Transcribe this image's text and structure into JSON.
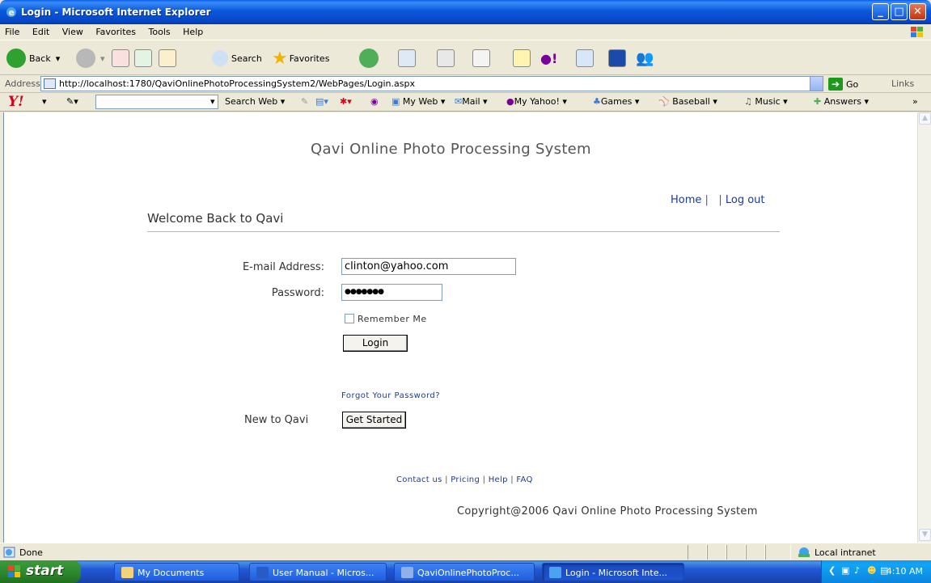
{
  "window": {
    "title": "Login - Microsoft Internet Explorer"
  },
  "menu": [
    "File",
    "Edit",
    "View",
    "Favorites",
    "Tools",
    "Help"
  ],
  "toolbar": {
    "back_label": "Back",
    "search_label": "Search",
    "favorites_label": "Favorites"
  },
  "address": {
    "label": "Address",
    "url": "http://localhost:1780/QaviOnlinePhotoProcessingSystem2/WebPages/Login.aspx",
    "go_label": "Go",
    "links_label": "Links"
  },
  "yahoo": {
    "logo": "Y!",
    "search_web": "Search Web",
    "items": [
      "My Web",
      "Mail",
      "My Yahoo!",
      "Games",
      "Baseball",
      "Music",
      "Answers"
    ]
  },
  "page": {
    "site_title": "Qavi Online Photo Processing System",
    "nav_home": "Home",
    "nav_sep1": "|",
    "nav_sep2": "|",
    "nav_logout": "Log out",
    "welcome": "Welcome Back to Qavi",
    "email_label": "E-mail Address:",
    "email_value": "clinton@yahoo.com",
    "password_label": "Password:",
    "password_value": "●●●●●●●",
    "remember_label": "Remember Me",
    "login_button": "Login",
    "forgot_link": "Forgot Your Password?",
    "new_label": "New to Qavi",
    "get_started_button": "Get Started",
    "footer": {
      "contact": "Contact us",
      "pricing": "Pricing",
      "help": "Help",
      "faq": "FAQ",
      "sep": "|"
    },
    "copyright": "Copyright@2006 Qavi Online Photo Processing System"
  },
  "status": {
    "text": "Done",
    "zone": "Local intranet"
  },
  "taskbar": {
    "start": "start",
    "tasks": [
      "My Documents",
      "User Manual - Micros...",
      "QaviOnlinePhotoProc...",
      "Login - Microsoft Inte..."
    ],
    "clock": "4:10 AM"
  },
  "colors": {
    "title_blue": "#0a58dc",
    "link_blue": "#1c3a97",
    "start_green": "#2f8a2f"
  }
}
